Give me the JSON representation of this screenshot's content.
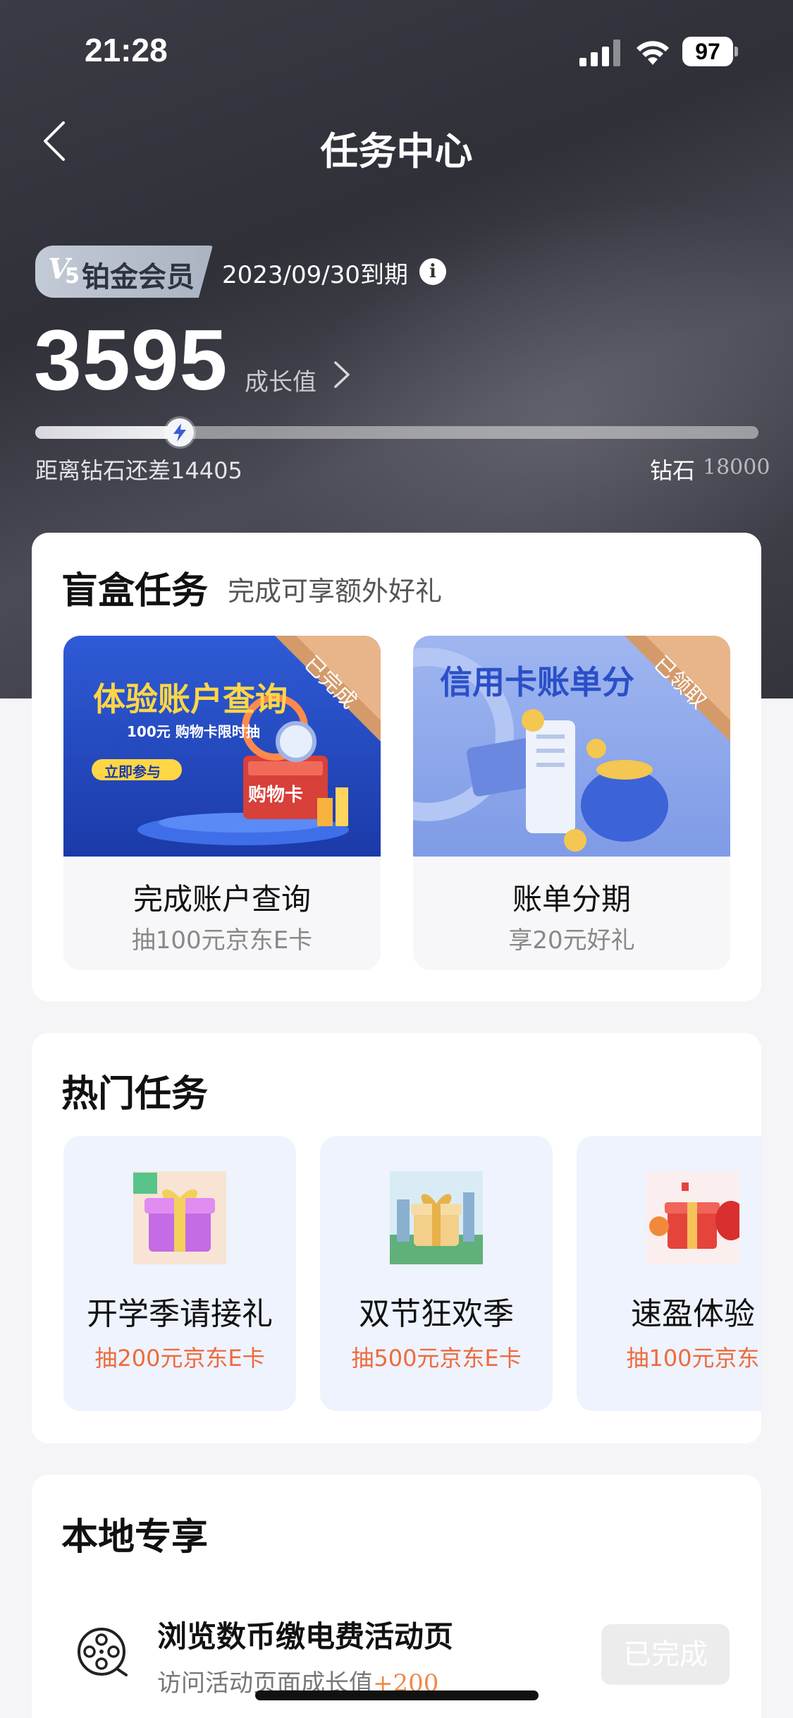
{
  "status_bar": {
    "time": "21:28",
    "battery": "97"
  },
  "nav": {
    "title": "任务中心"
  },
  "member": {
    "level_mark": "V",
    "level_number": "5",
    "name": "铂金会员",
    "expiry": "2023/09/30到期",
    "info_icon_text": "i"
  },
  "growth": {
    "value": "3595",
    "label": "成长值",
    "progress_fraction": 0.1997,
    "remaining_text": "距离钻石还差14405",
    "target_label": "钻石",
    "target_value": "18000"
  },
  "blind_box": {
    "title": "盲盒任务",
    "subtitle": "完成可享额外好礼",
    "tasks": [
      {
        "title": "完成账户查询",
        "subtitle": "抽100元京东E卡",
        "ribbon": "已完成",
        "banner_title": "体验账户查询",
        "banner_line": "100元 购物卡限时抽",
        "banner_button": "立即参与",
        "card_label": "购物卡"
      },
      {
        "title": "账单分期",
        "subtitle": "享20元好礼",
        "ribbon": "已领取",
        "banner_title": "信用卡账单分"
      }
    ]
  },
  "hot_tasks": {
    "title": "热门任务",
    "items": [
      {
        "title": "开学季请接礼",
        "subtitle": "抽200元京东E卡"
      },
      {
        "title": "双节狂欢季",
        "subtitle": "抽500元京东E卡"
      },
      {
        "title": "速盈体验",
        "subtitle": "抽100元京东"
      }
    ]
  },
  "local": {
    "title": "本地专享",
    "task_title": "浏览数币缴电费活动页",
    "task_sub": "访问活动页面成长值",
    "task_bonus": "+200",
    "button": "已完成"
  },
  "colors": {
    "accent_orange": "#ee6a3d",
    "hero_dark": "#2f3038",
    "banner_blue": "#2a4fc8"
  }
}
